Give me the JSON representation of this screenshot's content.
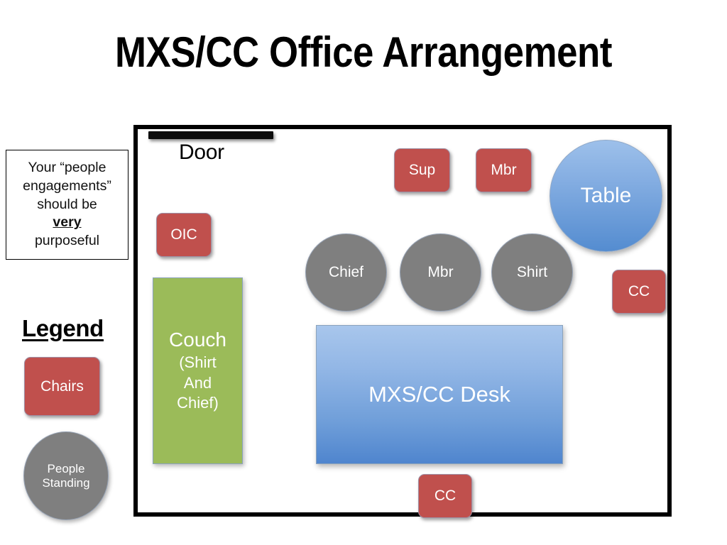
{
  "title": "MXS/CC Office Arrangement",
  "note": {
    "line1": "Your “people",
    "line2": "engagements”",
    "line3": "should be",
    "emphasis": "very",
    "line4": "purposeful"
  },
  "legend": {
    "title": "Legend",
    "chair_label": "Chairs",
    "person_label_line1": "People",
    "person_label_line2": "Standing"
  },
  "room": {
    "door_label": "Door",
    "chairs": [
      {
        "label": "OIC"
      },
      {
        "label": "Sup"
      },
      {
        "label": "Mbr"
      },
      {
        "label": "CC"
      },
      {
        "label": "CC"
      }
    ],
    "people": [
      {
        "label": "Chief"
      },
      {
        "label": "Mbr"
      },
      {
        "label": "Shirt"
      }
    ],
    "table_label": "Table",
    "couch": {
      "main": "Couch",
      "sub_line1": "(Shirt",
      "sub_line2": "And",
      "sub_line3": "Chief)"
    },
    "desk_label": "MXS/CC Desk"
  },
  "colors": {
    "chair_red": "#C0504D",
    "person_gray": "#7F7F7F",
    "couch_green": "#9BBB59",
    "table_blue": "#548CD0",
    "desk_blue": "#6F9ED9",
    "wall_black": "#000000",
    "background": "#FFFFFF"
  }
}
